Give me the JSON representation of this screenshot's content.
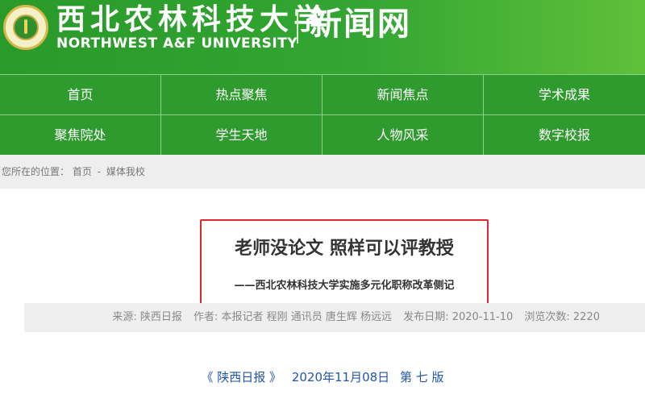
{
  "header": {
    "cn_name": "西北农林科技大学",
    "en_name": "NORTHWEST A&F UNIVERSITY",
    "site_name": "新闻网"
  },
  "nav": {
    "row1": [
      "首页",
      "热点聚焦",
      "新闻焦点",
      "学术成果"
    ],
    "row2": [
      "聚焦院处",
      "学生天地",
      "人物风采",
      "数字校报"
    ]
  },
  "breadcrumb": {
    "prefix": "您所在的位置：",
    "home": "首页",
    "separator": "-",
    "current": "媒体我校"
  },
  "article": {
    "title": "老师没论文 照样可以评教授",
    "subtitle": "——西北农林科技大学实施多元化职称改革侧记",
    "meta": {
      "source": "来源: 陕西日报",
      "author": "作者: 本报记者 程刚 通讯员 唐生辉 杨远远",
      "date": "发布日期: 2020-11-10",
      "views": "浏览次数: 2220"
    },
    "paper": {
      "name": "《 陕西日报 》",
      "date": "2020年11月08日",
      "page": "第 七 版"
    }
  },
  "colors": {
    "header_green": "#32a532",
    "nav_green": "#2f9b2f",
    "highlight_red": "#e3262c",
    "link_blue": "#2255aa"
  }
}
